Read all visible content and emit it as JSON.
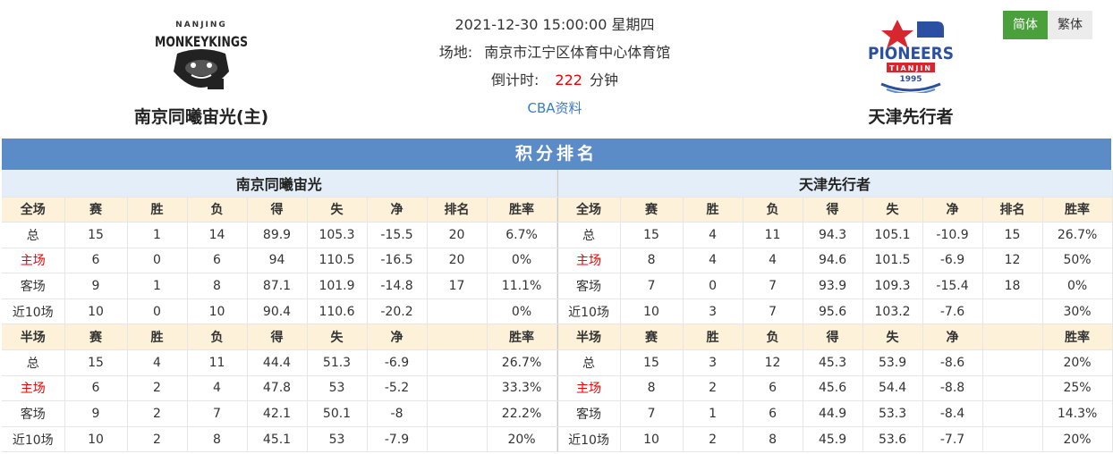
{
  "match": {
    "datetime": "2021-12-30 15:00:00 星期四",
    "venue_label": "场地:",
    "venue": "南京市江宁区体育中心体育馆",
    "countdown_label": "倒计时:",
    "countdown_value": "222",
    "countdown_unit": "分钟",
    "link": "CBA资料"
  },
  "home": {
    "name": "南京同曦宙光(主)",
    "logo_text_top": "NANJING",
    "logo_text_main": "MONKEYKINGS"
  },
  "away": {
    "name": "天津先行者",
    "logo_text_main": "PIONEERS",
    "logo_text_sub": "TIANJIN",
    "logo_year": "1995"
  },
  "lang": {
    "simplified": "简体",
    "traditional": "繁体"
  },
  "colors": {
    "accent_green": "#4aa13c",
    "title_blue": "#5b8cc8",
    "header_yellow": "#fdf2d9",
    "team_hdr_blue": "#e4eef8",
    "home_red": "#e00000"
  },
  "standings": {
    "title": "积分排名",
    "left": {
      "team": "南京同曦宙光",
      "full_header": [
        "全场",
        "赛",
        "胜",
        "负",
        "得",
        "失",
        "净",
        "排名",
        "胜率"
      ],
      "full_rows": [
        [
          "总",
          "15",
          "1",
          "14",
          "89.9",
          "105.3",
          "-15.5",
          "20",
          "6.7%"
        ],
        [
          "主场",
          "6",
          "0",
          "6",
          "94",
          "110.5",
          "-16.5",
          "20",
          "0%"
        ],
        [
          "客场",
          "9",
          "1",
          "8",
          "87.1",
          "101.9",
          "-14.8",
          "17",
          "11.1%"
        ],
        [
          "近10场",
          "10",
          "0",
          "10",
          "90.4",
          "110.6",
          "-20.2",
          "",
          "0%"
        ]
      ],
      "half_header": [
        "半场",
        "赛",
        "胜",
        "负",
        "得",
        "失",
        "净",
        "",
        "胜率"
      ],
      "half_rows": [
        [
          "总",
          "15",
          "4",
          "11",
          "44.4",
          "51.3",
          "-6.9",
          "",
          "26.7%"
        ],
        [
          "主场",
          "6",
          "2",
          "4",
          "47.8",
          "53",
          "-5.2",
          "",
          "33.3%"
        ],
        [
          "客场",
          "9",
          "2",
          "7",
          "42.1",
          "50.1",
          "-8",
          "",
          "22.2%"
        ],
        [
          "近10场",
          "10",
          "2",
          "8",
          "45.1",
          "53",
          "-7.9",
          "",
          "20%"
        ]
      ]
    },
    "right": {
      "team": "天津先行者",
      "full_header": [
        "全场",
        "赛",
        "胜",
        "负",
        "得",
        "失",
        "净",
        "排名",
        "胜率"
      ],
      "full_rows": [
        [
          "总",
          "15",
          "4",
          "11",
          "94.3",
          "105.1",
          "-10.9",
          "15",
          "26.7%"
        ],
        [
          "主场",
          "8",
          "4",
          "4",
          "94.6",
          "101.5",
          "-6.9",
          "12",
          "50%"
        ],
        [
          "客场",
          "7",
          "0",
          "7",
          "93.9",
          "109.3",
          "-15.4",
          "18",
          "0%"
        ],
        [
          "近10场",
          "10",
          "3",
          "7",
          "95.6",
          "103.2",
          "-7.6",
          "",
          "30%"
        ]
      ],
      "half_header": [
        "半场",
        "赛",
        "胜",
        "负",
        "得",
        "失",
        "净",
        "",
        "胜率"
      ],
      "half_rows": [
        [
          "总",
          "15",
          "3",
          "12",
          "45.3",
          "53.9",
          "-8.6",
          "",
          "20%"
        ],
        [
          "主场",
          "8",
          "2",
          "6",
          "45.6",
          "54.4",
          "-8.8",
          "",
          "25%"
        ],
        [
          "客场",
          "7",
          "1",
          "6",
          "44.9",
          "53.3",
          "-8.4",
          "",
          "14.3%"
        ],
        [
          "近10场",
          "10",
          "2",
          "8",
          "45.9",
          "53.6",
          "-7.7",
          "",
          "20%"
        ]
      ]
    }
  }
}
